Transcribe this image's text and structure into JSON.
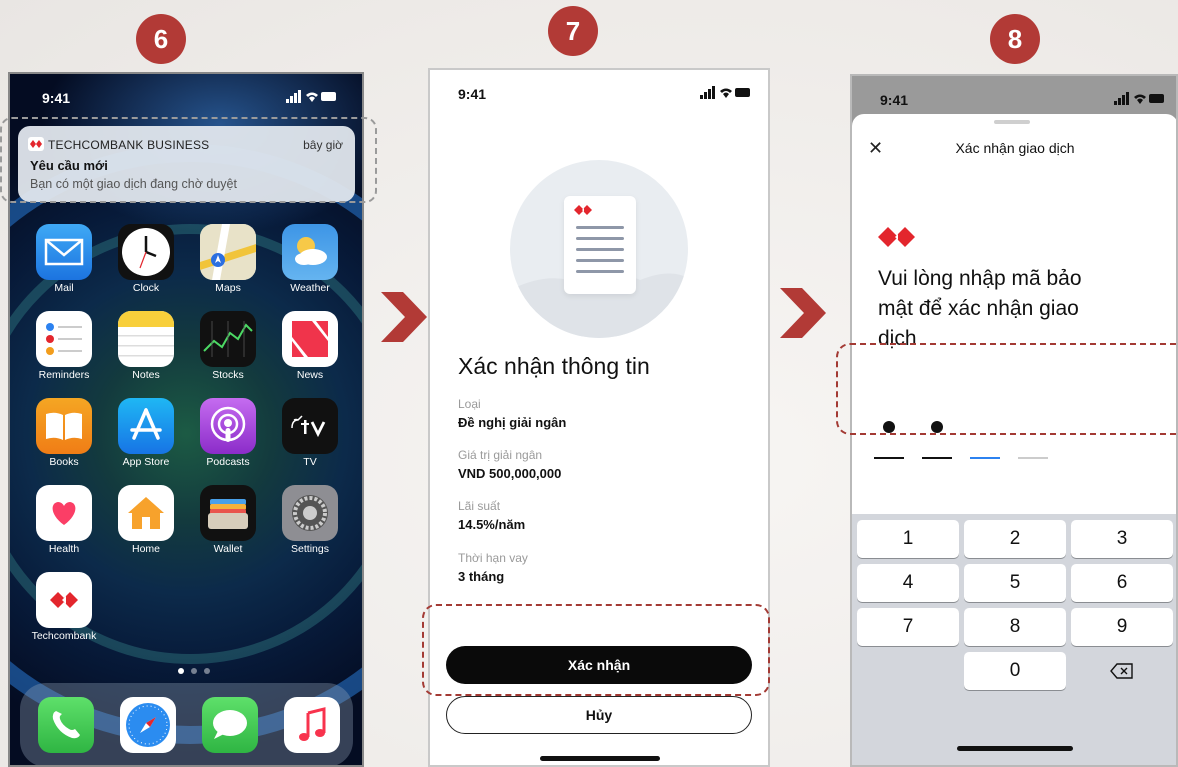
{
  "steps": {
    "s6": "6",
    "s7": "7",
    "s8": "8"
  },
  "colors": {
    "accent": "#b23a36",
    "brand_red": "#e3262d",
    "dash_red": "#a33a34"
  },
  "phone6": {
    "time": "9:41",
    "notification": {
      "app": "TECHCOMBANK BUSINESS",
      "when": "bây giờ",
      "title": "Yêu cầu mới",
      "body": "Bạn có một giao dịch đang chờ duyệt"
    },
    "apps": [
      {
        "label": "Mail",
        "icon": "mail-icon"
      },
      {
        "label": "Clock",
        "icon": "clock-icon"
      },
      {
        "label": "Maps",
        "icon": "maps-icon"
      },
      {
        "label": "Weather",
        "icon": "weather-icon"
      },
      {
        "label": "Reminders",
        "icon": "reminders-icon"
      },
      {
        "label": "Notes",
        "icon": "notes-icon"
      },
      {
        "label": "Stocks",
        "icon": "stocks-icon"
      },
      {
        "label": "News",
        "icon": "news-icon"
      },
      {
        "label": "Books",
        "icon": "books-icon"
      },
      {
        "label": "App Store",
        "icon": "app-store-icon"
      },
      {
        "label": "Podcasts",
        "icon": "podcasts-icon"
      },
      {
        "label": "TV",
        "icon": "tv-icon"
      },
      {
        "label": "Health",
        "icon": "health-icon"
      },
      {
        "label": "Home",
        "icon": "home-icon"
      },
      {
        "label": "Wallet",
        "icon": "wallet-icon"
      },
      {
        "label": "Settings",
        "icon": "settings-icon"
      },
      {
        "label": "Techcombank",
        "icon": "techcombank-icon"
      }
    ],
    "dock": [
      "phone-icon",
      "safari-icon",
      "messages-icon",
      "music-icon"
    ]
  },
  "phone7": {
    "time": "9:41",
    "heading": "Xác nhận thông tin",
    "fields": [
      {
        "label": "Loại",
        "value": "Đề nghị giải ngân"
      },
      {
        "label": "Giá trị giải ngân",
        "value": "VND 500,000,000"
      },
      {
        "label": "Lãi suất",
        "value": "14.5%/năm"
      },
      {
        "label": "Thời hạn vay",
        "value": "3 tháng"
      }
    ],
    "confirm_label": "Xác nhận",
    "cancel_label": "Hủy"
  },
  "phone8": {
    "time": "9:41",
    "close_glyph": "✕",
    "title": "Xác nhận giao dịch",
    "message": "Vui lòng nhập mã bảo mật để xác nhận giao dịch",
    "pin_filled": 2,
    "pin_length": 4,
    "keys": [
      "1",
      "2",
      "3",
      "4",
      "5",
      "6",
      "7",
      "8",
      "9",
      "0"
    ]
  }
}
